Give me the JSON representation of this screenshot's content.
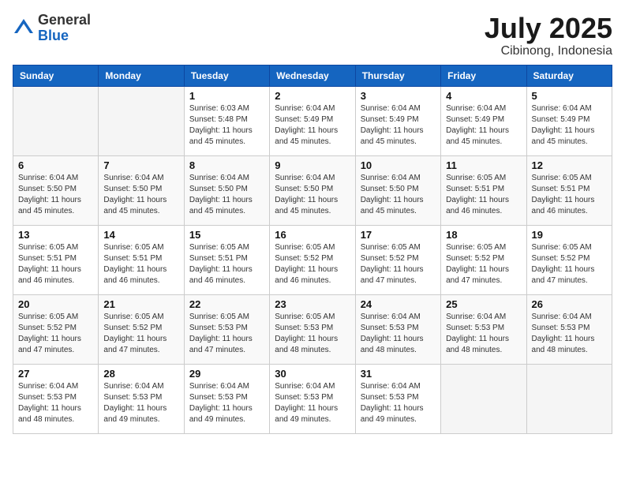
{
  "logo": {
    "general": "General",
    "blue": "Blue"
  },
  "title": {
    "month": "July 2025",
    "location": "Cibinong, Indonesia"
  },
  "weekdays": [
    "Sunday",
    "Monday",
    "Tuesday",
    "Wednesday",
    "Thursday",
    "Friday",
    "Saturday"
  ],
  "weeks": [
    [
      {
        "day": "",
        "sunrise": "",
        "sunset": "",
        "daylight": ""
      },
      {
        "day": "",
        "sunrise": "",
        "sunset": "",
        "daylight": ""
      },
      {
        "day": "1",
        "sunrise": "Sunrise: 6:03 AM",
        "sunset": "Sunset: 5:48 PM",
        "daylight": "Daylight: 11 hours and 45 minutes."
      },
      {
        "day": "2",
        "sunrise": "Sunrise: 6:04 AM",
        "sunset": "Sunset: 5:49 PM",
        "daylight": "Daylight: 11 hours and 45 minutes."
      },
      {
        "day": "3",
        "sunrise": "Sunrise: 6:04 AM",
        "sunset": "Sunset: 5:49 PM",
        "daylight": "Daylight: 11 hours and 45 minutes."
      },
      {
        "day": "4",
        "sunrise": "Sunrise: 6:04 AM",
        "sunset": "Sunset: 5:49 PM",
        "daylight": "Daylight: 11 hours and 45 minutes."
      },
      {
        "day": "5",
        "sunrise": "Sunrise: 6:04 AM",
        "sunset": "Sunset: 5:49 PM",
        "daylight": "Daylight: 11 hours and 45 minutes."
      }
    ],
    [
      {
        "day": "6",
        "sunrise": "Sunrise: 6:04 AM",
        "sunset": "Sunset: 5:50 PM",
        "daylight": "Daylight: 11 hours and 45 minutes."
      },
      {
        "day": "7",
        "sunrise": "Sunrise: 6:04 AM",
        "sunset": "Sunset: 5:50 PM",
        "daylight": "Daylight: 11 hours and 45 minutes."
      },
      {
        "day": "8",
        "sunrise": "Sunrise: 6:04 AM",
        "sunset": "Sunset: 5:50 PM",
        "daylight": "Daylight: 11 hours and 45 minutes."
      },
      {
        "day": "9",
        "sunrise": "Sunrise: 6:04 AM",
        "sunset": "Sunset: 5:50 PM",
        "daylight": "Daylight: 11 hours and 45 minutes."
      },
      {
        "day": "10",
        "sunrise": "Sunrise: 6:04 AM",
        "sunset": "Sunset: 5:50 PM",
        "daylight": "Daylight: 11 hours and 45 minutes."
      },
      {
        "day": "11",
        "sunrise": "Sunrise: 6:05 AM",
        "sunset": "Sunset: 5:51 PM",
        "daylight": "Daylight: 11 hours and 46 minutes."
      },
      {
        "day": "12",
        "sunrise": "Sunrise: 6:05 AM",
        "sunset": "Sunset: 5:51 PM",
        "daylight": "Daylight: 11 hours and 46 minutes."
      }
    ],
    [
      {
        "day": "13",
        "sunrise": "Sunrise: 6:05 AM",
        "sunset": "Sunset: 5:51 PM",
        "daylight": "Daylight: 11 hours and 46 minutes."
      },
      {
        "day": "14",
        "sunrise": "Sunrise: 6:05 AM",
        "sunset": "Sunset: 5:51 PM",
        "daylight": "Daylight: 11 hours and 46 minutes."
      },
      {
        "day": "15",
        "sunrise": "Sunrise: 6:05 AM",
        "sunset": "Sunset: 5:51 PM",
        "daylight": "Daylight: 11 hours and 46 minutes."
      },
      {
        "day": "16",
        "sunrise": "Sunrise: 6:05 AM",
        "sunset": "Sunset: 5:52 PM",
        "daylight": "Daylight: 11 hours and 46 minutes."
      },
      {
        "day": "17",
        "sunrise": "Sunrise: 6:05 AM",
        "sunset": "Sunset: 5:52 PM",
        "daylight": "Daylight: 11 hours and 47 minutes."
      },
      {
        "day": "18",
        "sunrise": "Sunrise: 6:05 AM",
        "sunset": "Sunset: 5:52 PM",
        "daylight": "Daylight: 11 hours and 47 minutes."
      },
      {
        "day": "19",
        "sunrise": "Sunrise: 6:05 AM",
        "sunset": "Sunset: 5:52 PM",
        "daylight": "Daylight: 11 hours and 47 minutes."
      }
    ],
    [
      {
        "day": "20",
        "sunrise": "Sunrise: 6:05 AM",
        "sunset": "Sunset: 5:52 PM",
        "daylight": "Daylight: 11 hours and 47 minutes."
      },
      {
        "day": "21",
        "sunrise": "Sunrise: 6:05 AM",
        "sunset": "Sunset: 5:52 PM",
        "daylight": "Daylight: 11 hours and 47 minutes."
      },
      {
        "day": "22",
        "sunrise": "Sunrise: 6:05 AM",
        "sunset": "Sunset: 5:53 PM",
        "daylight": "Daylight: 11 hours and 47 minutes."
      },
      {
        "day": "23",
        "sunrise": "Sunrise: 6:05 AM",
        "sunset": "Sunset: 5:53 PM",
        "daylight": "Daylight: 11 hours and 48 minutes."
      },
      {
        "day": "24",
        "sunrise": "Sunrise: 6:04 AM",
        "sunset": "Sunset: 5:53 PM",
        "daylight": "Daylight: 11 hours and 48 minutes."
      },
      {
        "day": "25",
        "sunrise": "Sunrise: 6:04 AM",
        "sunset": "Sunset: 5:53 PM",
        "daylight": "Daylight: 11 hours and 48 minutes."
      },
      {
        "day": "26",
        "sunrise": "Sunrise: 6:04 AM",
        "sunset": "Sunset: 5:53 PM",
        "daylight": "Daylight: 11 hours and 48 minutes."
      }
    ],
    [
      {
        "day": "27",
        "sunrise": "Sunrise: 6:04 AM",
        "sunset": "Sunset: 5:53 PM",
        "daylight": "Daylight: 11 hours and 48 minutes."
      },
      {
        "day": "28",
        "sunrise": "Sunrise: 6:04 AM",
        "sunset": "Sunset: 5:53 PM",
        "daylight": "Daylight: 11 hours and 49 minutes."
      },
      {
        "day": "29",
        "sunrise": "Sunrise: 6:04 AM",
        "sunset": "Sunset: 5:53 PM",
        "daylight": "Daylight: 11 hours and 49 minutes."
      },
      {
        "day": "30",
        "sunrise": "Sunrise: 6:04 AM",
        "sunset": "Sunset: 5:53 PM",
        "daylight": "Daylight: 11 hours and 49 minutes."
      },
      {
        "day": "31",
        "sunrise": "Sunrise: 6:04 AM",
        "sunset": "Sunset: 5:53 PM",
        "daylight": "Daylight: 11 hours and 49 minutes."
      },
      {
        "day": "",
        "sunrise": "",
        "sunset": "",
        "daylight": ""
      },
      {
        "day": "",
        "sunrise": "",
        "sunset": "",
        "daylight": ""
      }
    ]
  ]
}
